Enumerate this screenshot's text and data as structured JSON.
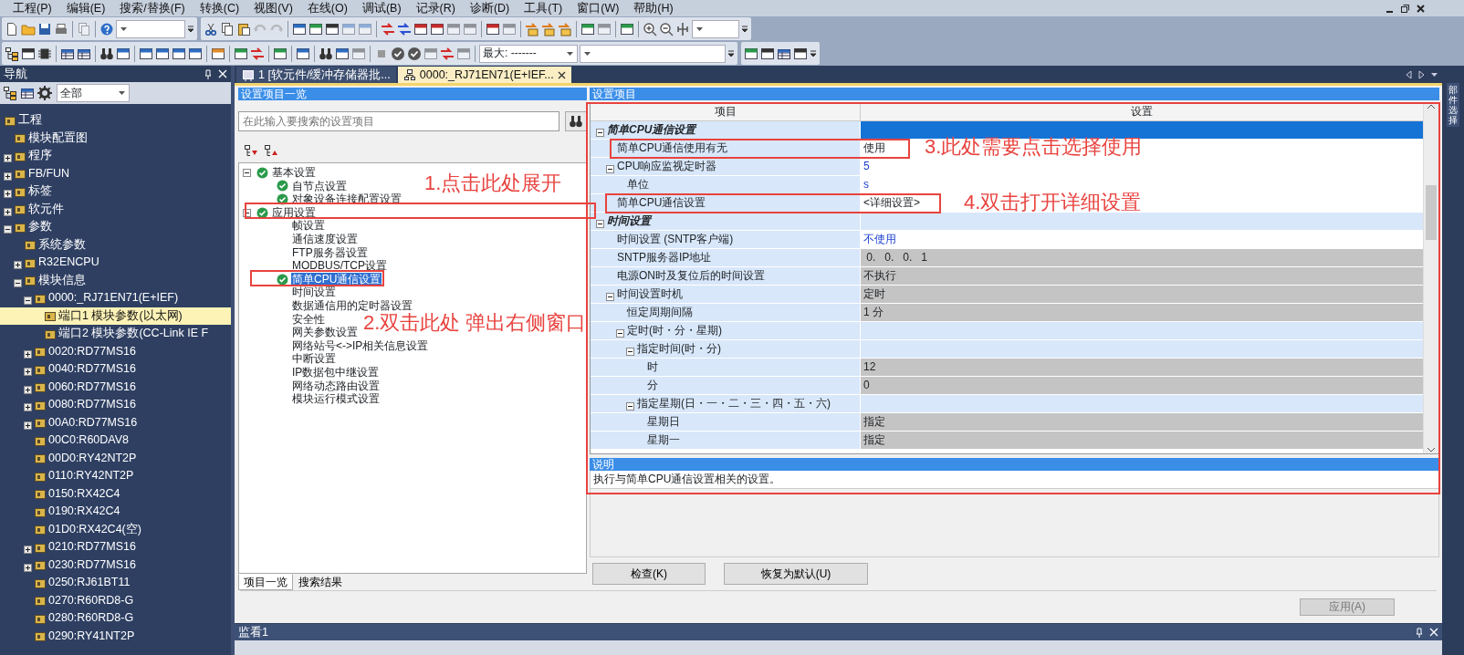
{
  "menu": [
    "工程(P)",
    "编辑(E)",
    "搜索/替换(F)",
    "转换(C)",
    "视图(V)",
    "在线(O)",
    "调试(B)",
    "记录(R)",
    "诊断(D)",
    "工具(T)",
    "窗口(W)",
    "帮助(H)"
  ],
  "toolbar": {
    "zoom_level": "最大: -------"
  },
  "navigation": {
    "title": "导航",
    "filter": "全部",
    "tree": [
      {
        "label": "工程",
        "selected": false,
        "children": [
          {
            "label": "模块配置图",
            "selected": false
          },
          {
            "label": "程序",
            "selected": false,
            "expanded": false
          },
          {
            "label": "FB/FUN",
            "selected": false,
            "expanded": false
          },
          {
            "label": "标签",
            "selected": false,
            "expanded": false
          },
          {
            "label": "软元件",
            "selected": false,
            "expanded": false
          },
          {
            "label": "参数",
            "selected": false,
            "expanded": true,
            "children": [
              {
                "label": "系统参数",
                "selected": false
              },
              {
                "label": "R32ENCPU",
                "selected": false,
                "expanded": false
              },
              {
                "label": "模块信息",
                "selected": false,
                "expanded": true,
                "children": [
                  {
                    "label": "0000:_RJ71EN71(E+IEF)",
                    "selected": false,
                    "expanded": true,
                    "children": [
                      {
                        "label": "端口1 模块参数(以太网)",
                        "selected": true
                      },
                      {
                        "label": "端口2 模块参数(CC-Link IE F",
                        "selected": false
                      }
                    ]
                  },
                  {
                    "label": "0020:RD77MS16",
                    "selected": false,
                    "expanded": false
                  },
                  {
                    "label": "0040:RD77MS16",
                    "selected": false,
                    "expanded": false
                  },
                  {
                    "label": "0060:RD77MS16",
                    "selected": false,
                    "expanded": false
                  },
                  {
                    "label": "0080:RD77MS16",
                    "selected": false,
                    "expanded": false
                  },
                  {
                    "label": "00A0:RD77MS16",
                    "selected": false,
                    "expanded": false
                  },
                  {
                    "label": "00C0:R60DAV8",
                    "selected": false
                  },
                  {
                    "label": "00D0:RY42NT2P",
                    "selected": false
                  },
                  {
                    "label": "0110:RY42NT2P",
                    "selected": false
                  },
                  {
                    "label": "0150:RX42C4",
                    "selected": false
                  },
                  {
                    "label": "0190:RX42C4",
                    "selected": false
                  },
                  {
                    "label": "01D0:RX42C4(空)",
                    "selected": false
                  },
                  {
                    "label": "0210:RD77MS16",
                    "selected": false,
                    "expanded": false
                  },
                  {
                    "label": "0230:RD77MS16",
                    "selected": false,
                    "expanded": false
                  },
                  {
                    "label": "0250:RJ61BT11",
                    "selected": false
                  },
                  {
                    "label": "0270:R60RD8-G",
                    "selected": false
                  },
                  {
                    "label": "0280:R60RD8-G",
                    "selected": false
                  },
                  {
                    "label": "0290:RY41NT2P",
                    "selected": false
                  }
                ]
              }
            ]
          }
        ]
      }
    ]
  },
  "tabs": [
    {
      "label": "1 [软元件/缓冲存储器批...",
      "selected": false
    },
    {
      "label": "0000:_RJ71EN71(E+IEF...",
      "selected": true
    }
  ],
  "settings_list": {
    "title": "设置项目一览",
    "search": {
      "placeholder": "在此输入要搜索的设置项目"
    },
    "tree": [
      {
        "label": "基本设置",
        "checked": true,
        "selected": false,
        "expanded": true,
        "children": [
          {
            "label": "自节点设置",
            "checked": true,
            "selected": false
          },
          {
            "label": "对象设备连接配置设置",
            "checked": true,
            "selected": false
          }
        ]
      },
      {
        "label": "应用设置",
        "checked": true,
        "selected": false,
        "expanded": true,
        "children": [
          {
            "label": "帧设置",
            "checked": false,
            "selected": false
          },
          {
            "label": "通信速度设置",
            "checked": false,
            "selected": false
          },
          {
            "label": "FTP服务器设置",
            "checked": false,
            "selected": false
          },
          {
            "label": "MODBUS/TCP设置",
            "checked": false,
            "selected": false
          },
          {
            "label": "简单CPU通信设置",
            "checked": true,
            "selected": true
          },
          {
            "label": "时间设置",
            "checked": false,
            "selected": false
          },
          {
            "label": "数据通信用的定时器设置",
            "checked": false,
            "selected": false
          },
          {
            "label": "安全性",
            "checked": false,
            "selected": false
          },
          {
            "label": "网关参数设置",
            "checked": false,
            "selected": false
          },
          {
            "label": "网络站号<->IP相关信息设置",
            "checked": false,
            "selected": false
          },
          {
            "label": "中断设置",
            "checked": false,
            "selected": false
          },
          {
            "label": "IP数据包中继设置",
            "checked": false,
            "selected": false
          },
          {
            "label": "网络动态路由设置",
            "checked": false,
            "selected": false
          },
          {
            "label": "模块运行模式设置",
            "checked": false,
            "selected": false
          }
        ]
      }
    ],
    "tabs": [
      {
        "label": "项目一览",
        "selected": true
      },
      {
        "label": "搜索结果",
        "selected": false
      }
    ]
  },
  "settings": {
    "title": "设置项目",
    "columns": [
      "项目",
      "设置"
    ],
    "rows": [
      {
        "label": "简单CPU通信设置",
        "kind": "group",
        "selected": true,
        "expanded": true,
        "children": [
          {
            "label": "简单CPU通信使用有无",
            "kind": "item",
            "value": "使用",
            "selected": false,
            "disabled": false,
            "changed": false
          },
          {
            "label": "CPU响应监视定时器",
            "kind": "item",
            "value": "5",
            "selected": false,
            "disabled": false,
            "changed": true,
            "expanded": true,
            "children": [
              {
                "label": "单位",
                "kind": "item",
                "value": "s",
                "selected": false,
                "disabled": false,
                "changed": true
              }
            ]
          },
          {
            "label": "简单CPU通信设置",
            "kind": "item",
            "value": "<详细设置>",
            "selected": false,
            "disabled": false,
            "changed": false
          }
        ]
      },
      {
        "label": "时间设置",
        "kind": "group",
        "selected": false,
        "expanded": true,
        "children": [
          {
            "label": "时间设置 (SNTP客户端)",
            "kind": "item",
            "value": "不使用",
            "selected": false,
            "disabled": false,
            "changed": true
          },
          {
            "label": "SNTP服务器IP地址",
            "kind": "item",
            "value": " 0.   0.   0.   1",
            "selected": false,
            "disabled": true,
            "changed": false
          },
          {
            "label": "电源ON时及复位后的时间设置",
            "kind": "item",
            "value": "不执行",
            "selected": false,
            "disabled": true,
            "changed": false
          },
          {
            "label": "时间设置时机",
            "kind": "item",
            "value": "定时",
            "selected": false,
            "disabled": true,
            "changed": false,
            "expanded": true,
            "children": [
              {
                "label": "恒定周期间隔",
                "kind": "item",
                "value": "1 分",
                "selected": false,
                "disabled": true,
                "changed": false
              },
              {
                "label": "定时(时・分・星期)",
                "kind": "item",
                "selected": false,
                "expanded": true,
                "children": [
                  {
                    "label": "指定时间(时・分)",
                    "kind": "item",
                    "selected": false,
                    "expanded": true,
                    "children": [
                      {
                        "label": "时",
                        "kind": "item",
                        "value": "12",
                        "selected": false,
                        "disabled": true,
                        "changed": false
                      },
                      {
                        "label": "分",
                        "kind": "item",
                        "value": "0",
                        "selected": false,
                        "disabled": true,
                        "changed": false
                      }
                    ]
                  },
                  {
                    "label": "指定星期(日・一・二・三・四・五・六)",
                    "kind": "item",
                    "selected": false,
                    "expanded": true,
                    "children": [
                      {
                        "label": "星期日",
                        "kind": "item",
                        "value": "指定",
                        "selected": false,
                        "disabled": true,
                        "changed": false
                      },
                      {
                        "label": "星期一",
                        "kind": "item",
                        "value": "指定",
                        "selected": false,
                        "disabled": true,
                        "changed": false
                      }
                    ]
                  }
                ]
              }
            ]
          }
        ]
      }
    ],
    "description": {
      "title": "说明",
      "text": "执行与简单CPU通信设置相关的设置。"
    },
    "buttons": [
      "检查(K)",
      "恢复为默认(U)"
    ]
  },
  "apply_button": {
    "label": "应用(A)",
    "disabled": true
  },
  "watch_panel": {
    "title": "监看1"
  },
  "side_tab": "部件选择",
  "annotations": [
    {
      "text": "1.点击此处展开"
    },
    {
      "text": "2.双击此处 弹出右侧窗口"
    },
    {
      "text": "3.此处需要点击选择使用"
    },
    {
      "text": "4.双击打开详细设置"
    }
  ]
}
